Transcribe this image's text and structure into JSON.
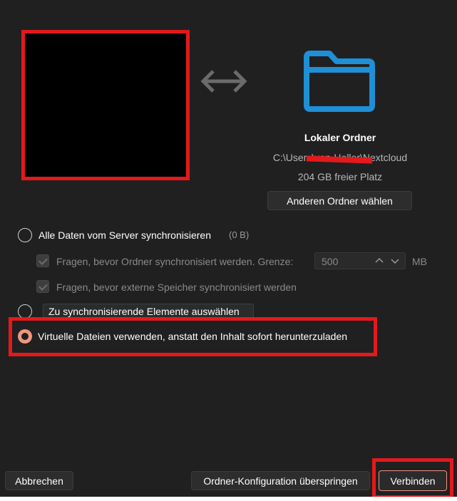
{
  "local": {
    "title": "Lokaler Ordner",
    "path": "C:\\Users\\von-Heller\\Nextcloud",
    "free_space": "204 GB freier Platz",
    "choose_button": "Anderen Ordner wählen"
  },
  "options": {
    "sync_all_label": "Alle Daten vom Server synchronisieren",
    "sync_all_size": "(0 B)",
    "ask_folders_label": "Fragen, bevor Ordner synchronisiert werden. Grenze:",
    "limit_value": "500",
    "limit_unit": "MB",
    "ask_external_label": "Fragen, bevor externe Speicher synchronisiert werden",
    "select_items_button": "Zu synchronisierende Elemente auswählen",
    "virtual_files_label": "Virtuelle Dateien verwenden, anstatt den Inhalt sofort herunterzuladen"
  },
  "footer": {
    "cancel": "Abbrechen",
    "skip": "Ordner-Konfiguration überspringen",
    "connect": "Verbinden"
  },
  "colors": {
    "accent": "#f0967f",
    "folder": "#1f8fd6",
    "highlight": "#e3191c"
  }
}
